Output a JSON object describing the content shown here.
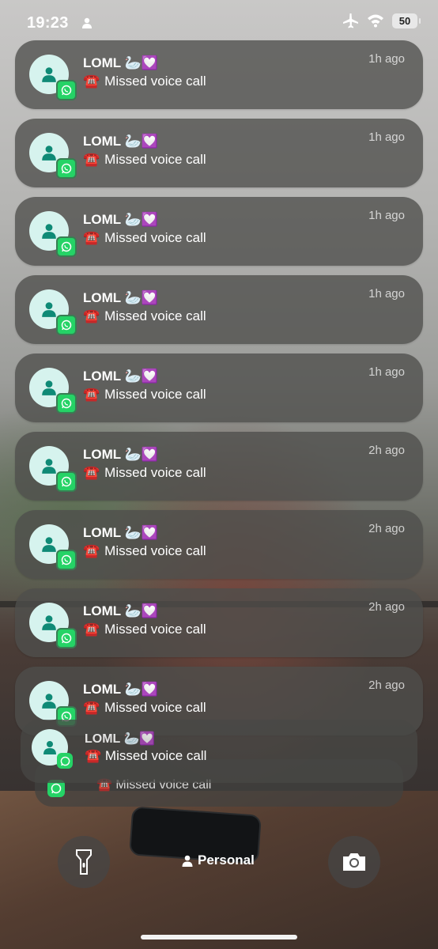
{
  "status_bar": {
    "time": "19:23",
    "battery": "50"
  },
  "notifications": [
    {
      "title": "LOML 🦢💟",
      "body": "Missed voice call",
      "time": "1h ago"
    },
    {
      "title": "LOML 🦢💟",
      "body": "Missed voice call",
      "time": "1h ago"
    },
    {
      "title": "LOML 🦢💟",
      "body": "Missed voice call",
      "time": "1h ago"
    },
    {
      "title": "LOML 🦢💟",
      "body": "Missed voice call",
      "time": "1h ago"
    },
    {
      "title": "LOML 🦢💟",
      "body": "Missed voice call",
      "time": "1h ago"
    },
    {
      "title": "LOML 🦢💟",
      "body": "Missed voice call",
      "time": "2h ago"
    },
    {
      "title": "LOML 🦢💟",
      "body": "Missed voice call",
      "time": "2h ago"
    },
    {
      "title": "LOML 🦢💟",
      "body": "Missed voice call",
      "time": "2h ago"
    },
    {
      "title": "LOML 🦢💟",
      "body": "Missed voice call",
      "time": "2h ago"
    }
  ],
  "stacked": [
    {
      "title": "LOML 🦢💟",
      "body": "Missed voice call"
    },
    {
      "body": "Missed voice call"
    }
  ],
  "icons": {
    "call": "☎️",
    "app": "whatsapp-icon",
    "avatar": "person-icon"
  },
  "bottom": {
    "focus_label": "Personal"
  },
  "colors": {
    "whatsapp": "#25d366",
    "avatar_bg": "#d6f3ee",
    "avatar_fg": "#0f8a76"
  }
}
